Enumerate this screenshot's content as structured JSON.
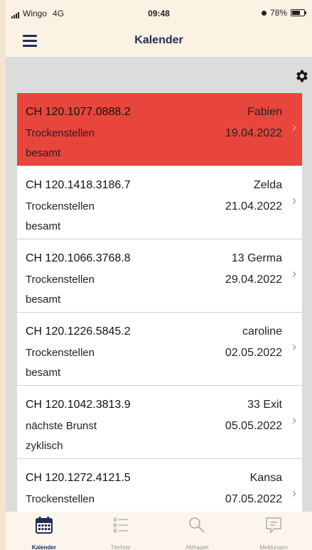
{
  "status_bar": {
    "carrier": "Wingo",
    "network": "4G",
    "time": "09:48",
    "battery_percent": "78%",
    "battery_level": 0.78
  },
  "header": {
    "title": "Kalender",
    "menu_icon": "hamburger-menu-icon"
  },
  "toolbar": {
    "settings_icon": "gear-icon"
  },
  "colors": {
    "highlight_row": "#e8453c",
    "nav_text": "#1f2d5a",
    "header_bg": "#fbf2e4"
  },
  "calendar_items": [
    {
      "id": "CH 120.1077.0888.2",
      "name": "Fabien",
      "status_line1": "Trockenstellen",
      "status_line2": "besamt",
      "date": "19.04.2022",
      "highlighted": true
    },
    {
      "id": "CH 120.1418.3186.7",
      "name": "Zelda",
      "status_line1": "Trockenstellen",
      "status_line2": "besamt",
      "date": "21.04.2022",
      "highlighted": false
    },
    {
      "id": "CH 120.1066.3768.8",
      "name": "13 Germa",
      "status_line1": "Trockenstellen",
      "status_line2": "besamt",
      "date": "29.04.2022",
      "highlighted": false
    },
    {
      "id": "CH 120.1226.5845.2",
      "name": "caroline",
      "status_line1": "Trockenstellen",
      "status_line2": "besamt",
      "date": "02.05.2022",
      "highlighted": false
    },
    {
      "id": "CH 120.1042.3813.9",
      "name": "33 Exit",
      "status_line1": "nächste Brunst",
      "status_line2": "zyklisch",
      "date": "05.05.2022",
      "highlighted": false
    },
    {
      "id": "CH 120.1272.4121.5",
      "name": "Kansa",
      "status_line1": "Trockenstellen",
      "status_line2": "",
      "date": "07.05.2022",
      "highlighted": false
    }
  ],
  "tabs": [
    {
      "label": "Kalender",
      "icon": "calendar-icon",
      "active": true
    },
    {
      "label": "Tierliste",
      "icon": "list-icon",
      "active": false
    },
    {
      "label": "Abfragen",
      "icon": "search-icon",
      "active": false
    },
    {
      "label": "Meldungen",
      "icon": "message-icon",
      "active": false
    }
  ]
}
